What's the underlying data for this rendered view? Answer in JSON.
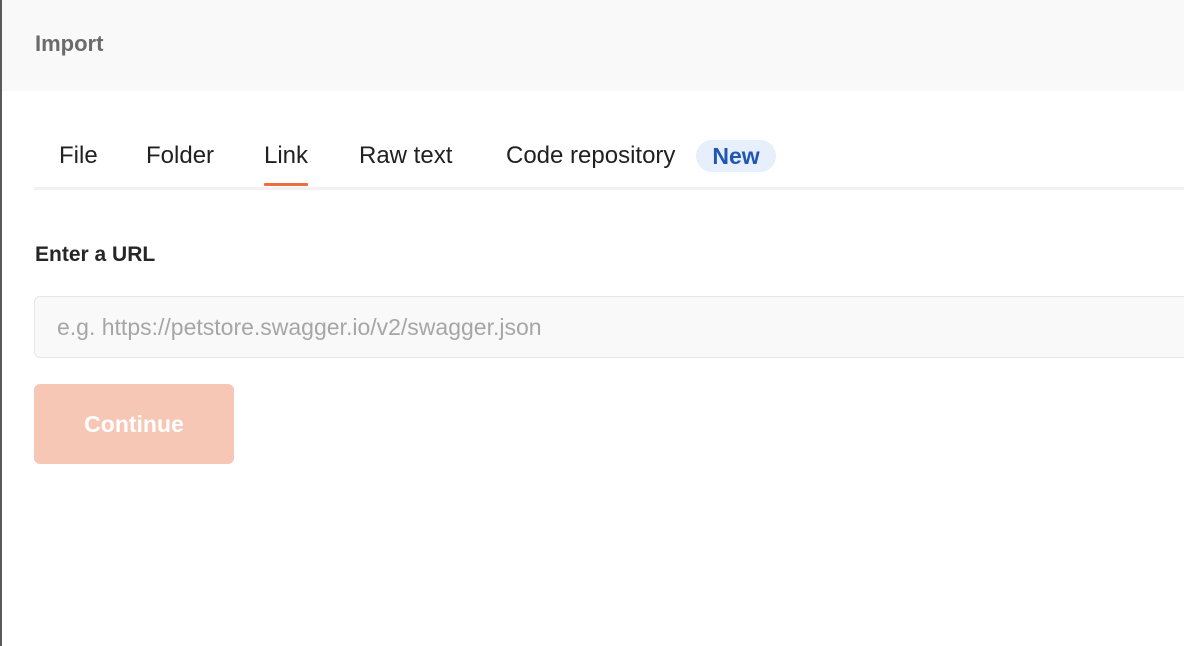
{
  "dialog": {
    "title": "Import"
  },
  "tabs": [
    {
      "label": "File",
      "active": false
    },
    {
      "label": "Folder",
      "active": false
    },
    {
      "label": "Link",
      "active": true
    },
    {
      "label": "Raw text",
      "active": false
    },
    {
      "label": "Code repository",
      "active": false,
      "badge": "New"
    }
  ],
  "form": {
    "label": "Enter a URL",
    "url_value": "",
    "url_placeholder": "e.g. https://petstore.swagger.io/v2/swagger.json",
    "continue_label": "Continue",
    "continue_enabled": false
  },
  "colors": {
    "accent": "#ef6c3e",
    "button_disabled_bg": "#f7c7b6",
    "badge_bg": "#e6effb",
    "badge_text": "#1f56b3",
    "header_bg": "#f9f9f9"
  }
}
